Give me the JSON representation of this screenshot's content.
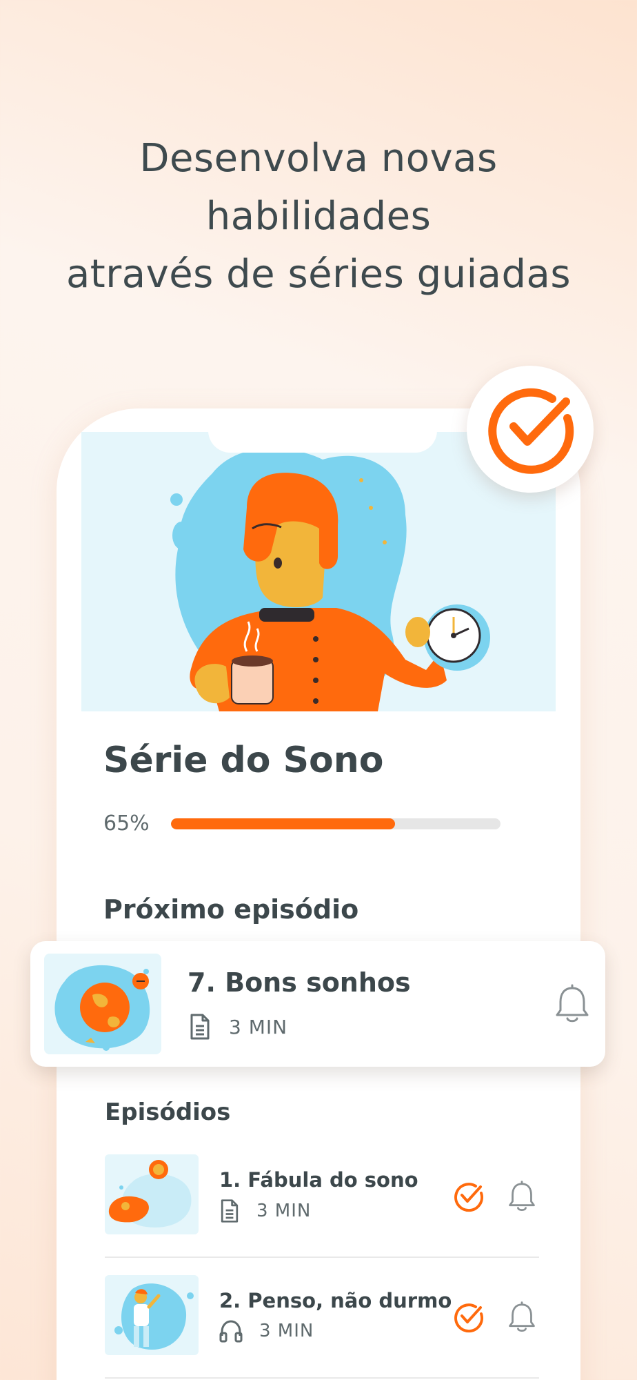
{
  "headline": {
    "line1": "Desenvolva novas",
    "line2": "habilidades",
    "line3": "através de séries guiadas"
  },
  "series": {
    "title": "Série do Sono",
    "progress_label": "65%",
    "progress_fraction": 0.68
  },
  "next_episode": {
    "section_label": "Próximo episódio",
    "title": "7. Bons sonhos",
    "duration": "3 MIN",
    "type_icon": "document-icon"
  },
  "episodes": {
    "section_label": "Episódios",
    "items": [
      {
        "title": "1. Fábula do sono",
        "duration": "3 MIN",
        "type_icon": "document-icon",
        "completed": true
      },
      {
        "title": "2. Penso, não durmo",
        "duration": "3 MIN",
        "type_icon": "headphones-icon",
        "completed": true
      }
    ]
  },
  "colors": {
    "accent": "#ff6a0d",
    "illustration_blue": "#7cd3ef",
    "text_dark": "#3c474b"
  }
}
